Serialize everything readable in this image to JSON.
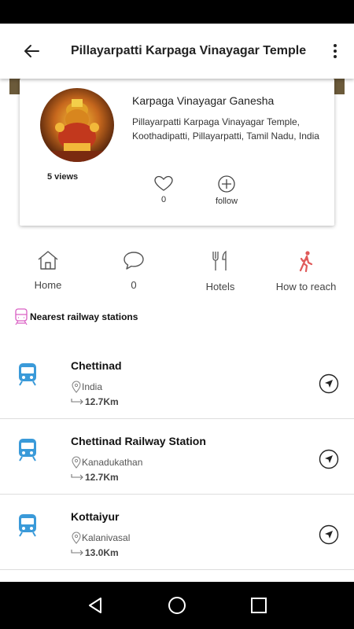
{
  "app_bar": {
    "title": "Pillayarpatti Karpaga Vinayagar Temple"
  },
  "profile": {
    "deity_name": "Karpaga Vinayagar Ganesha",
    "address": "Pillayarpatti Karpaga Vinayagar Temple, Koothadipatti, Pillayarpatti, Tamil Nadu, India",
    "views": "5 views",
    "like_count": "0",
    "follow_label": "follow"
  },
  "nav": {
    "home": "Home",
    "comments_count": "0",
    "hotels": "Hotels",
    "how_to_reach": "How to reach"
  },
  "section": {
    "title": "Nearest railway stations"
  },
  "stations": [
    {
      "name": "Chettinad",
      "location": "India",
      "distance": "12.7Km"
    },
    {
      "name": "Chettinad Railway Station",
      "location": "Kanadukathan",
      "distance": "12.7Km"
    },
    {
      "name": "Kottaiyur",
      "location": "Kalanivasal",
      "distance": "13.0Km"
    }
  ],
  "colors": {
    "train_icon": "#3a9ad9",
    "walk_icon": "#e05a5a",
    "rail_heading_icon": "#d95fc4"
  },
  "icons": {
    "back": "back-arrow-icon",
    "more": "more-vert-icon",
    "like": "heart-icon",
    "follow": "plus-circle-icon",
    "home": "home-icon",
    "comments": "chat-bubble-icon",
    "hotels": "fork-knife-icon",
    "reach": "walking-person-icon",
    "station": "train-icon",
    "navigate": "navigation-arrow-icon"
  }
}
